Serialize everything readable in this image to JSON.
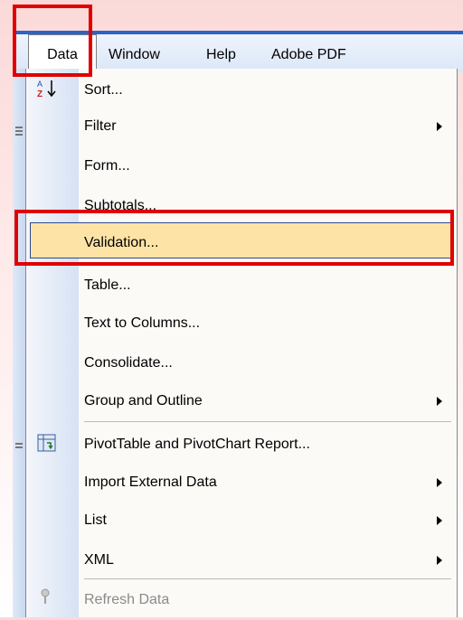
{
  "menubar": {
    "items": [
      {
        "label": "Data"
      },
      {
        "label": "Window"
      },
      {
        "label": "Help"
      },
      {
        "label": "Adobe PDF"
      }
    ]
  },
  "menu": {
    "items": [
      {
        "label": "Sort...",
        "icon": "sort-az-icon"
      },
      {
        "label": "Filter",
        "submenu": true
      },
      {
        "label": "Form..."
      },
      {
        "label": "Subtotals..."
      },
      {
        "label": "Validation...",
        "highlighted": true
      },
      {
        "label": "Table..."
      },
      {
        "label": "Text to Columns..."
      },
      {
        "label": "Consolidate..."
      },
      {
        "label": "Group and Outline",
        "submenu": true
      },
      {
        "label": "PivotTable and PivotChart Report...",
        "icon": "pivot-table-icon"
      },
      {
        "label": "Import External Data",
        "submenu": true
      },
      {
        "label": "List",
        "submenu": true
      },
      {
        "label": "XML",
        "submenu": true
      },
      {
        "label": "Refresh Data",
        "icon": "refresh-icon",
        "disabled": true
      }
    ]
  },
  "colors": {
    "highlight_fill": "#fde3a6",
    "annotation_red": "#e00000",
    "menubar_accent": "#2c63c6"
  }
}
